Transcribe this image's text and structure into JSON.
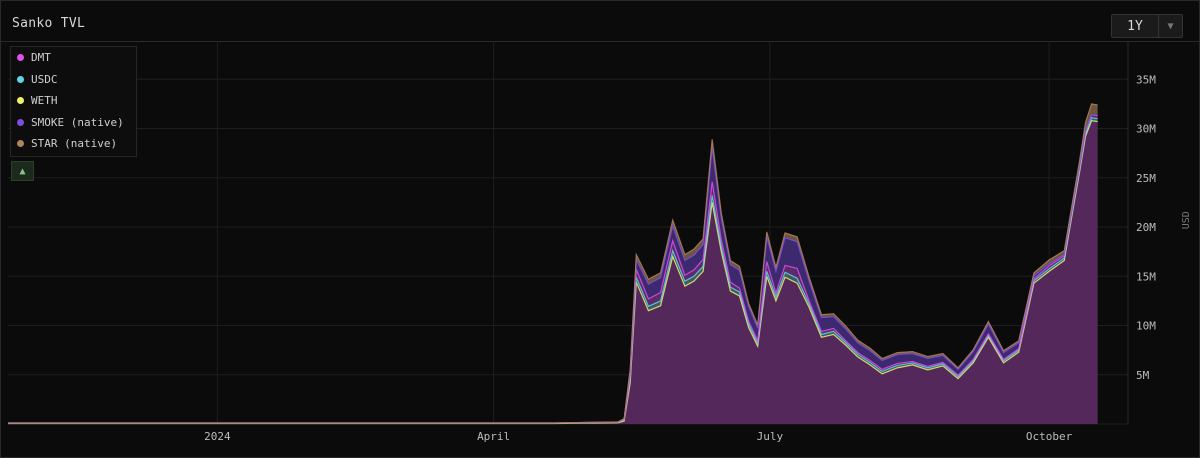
{
  "header": {
    "title": "Sanko TVL"
  },
  "range_selector": {
    "value": "1Y"
  },
  "legend_toggle": {
    "icon": "chevron-up-icon"
  },
  "chart_data": {
    "type": "area",
    "stacked": true,
    "title": "Sanko TVL",
    "ylabel": "USD",
    "ylim": [
      0,
      35000000
    ],
    "y_ticks": [
      {
        "value": 5000000,
        "label": "5M"
      },
      {
        "value": 10000000,
        "label": "10M"
      },
      {
        "value": 15000000,
        "label": "15M"
      },
      {
        "value": 20000000,
        "label": "20M"
      },
      {
        "value": 25000000,
        "label": "25M"
      },
      {
        "value": 30000000,
        "label": "30M"
      },
      {
        "value": 35000000,
        "label": "35M"
      }
    ],
    "x_ticks": [
      {
        "date": "2024-01-01",
        "label": "2024"
      },
      {
        "date": "2024-04-01",
        "label": "April"
      },
      {
        "date": "2024-07-01",
        "label": "July"
      },
      {
        "date": "2024-10-01",
        "label": "October"
      }
    ],
    "x_range": [
      "2023-10-24",
      "2024-10-27"
    ],
    "grid": true,
    "legend_position": "top-left",
    "legend": [
      {
        "name": "DMT",
        "color": "#e04ff0"
      },
      {
        "name": "USDC",
        "color": "#5fd7e8"
      },
      {
        "name": "WETH",
        "color": "#f2f06a"
      },
      {
        "name": "SMOKE (native)",
        "color": "#7d4ee0"
      },
      {
        "name": "STAR (native)",
        "color": "#b0845a"
      }
    ],
    "dates": [
      "2023-10-24",
      "2024-04-21",
      "2024-05-12",
      "2024-05-14",
      "2024-05-16",
      "2024-05-18",
      "2024-05-22",
      "2024-05-26",
      "2024-05-30",
      "2024-06-03",
      "2024-06-06",
      "2024-06-09",
      "2024-06-12",
      "2024-06-15",
      "2024-06-18",
      "2024-06-21",
      "2024-06-24",
      "2024-06-27",
      "2024-06-30",
      "2024-07-03",
      "2024-07-06",
      "2024-07-10",
      "2024-07-14",
      "2024-07-18",
      "2024-07-22",
      "2024-07-26",
      "2024-07-30",
      "2024-08-03",
      "2024-08-07",
      "2024-08-12",
      "2024-08-17",
      "2024-08-22",
      "2024-08-27",
      "2024-09-01",
      "2024-09-06",
      "2024-09-11",
      "2024-09-16",
      "2024-09-21",
      "2024-09-26",
      "2024-10-01",
      "2024-10-06",
      "2024-10-09",
      "2024-10-11",
      "2024-10-13",
      "2024-10-15",
      "2024-10-17"
    ],
    "series": [
      {
        "name": "DMT",
        "values": [
          20000,
          20000,
          20000,
          80000,
          300000,
          800000,
          750000,
          850000,
          1000000,
          600000,
          650000,
          700000,
          1400000,
          700000,
          500000,
          400000,
          300000,
          250000,
          1000000,
          400000,
          700000,
          1000000,
          300000,
          300000,
          300000,
          200000,
          200000,
          200000,
          200000,
          200000,
          150000,
          150000,
          150000,
          150000,
          150000,
          150000,
          150000,
          150000,
          200000,
          300000,
          250000,
          250000,
          250000,
          300000,
          300000,
          300000
        ]
      },
      {
        "name": "USDC",
        "values": [
          30000,
          30000,
          60000,
          100000,
          400000,
          500000,
          450000,
          500000,
          600000,
          500000,
          500000,
          500000,
          700000,
          500000,
          400000,
          400000,
          350000,
          300000,
          500000,
          400000,
          500000,
          500000,
          350000,
          300000,
          300000,
          250000,
          250000,
          250000,
          250000,
          250000,
          200000,
          200000,
          200000,
          200000,
          200000,
          200000,
          200000,
          200000,
          250000,
          250000,
          250000,
          250000,
          250000,
          300000,
          300000,
          300000
        ]
      },
      {
        "name": "WETH",
        "values": [
          50000,
          50000,
          120000,
          300000,
          4200000,
          14400000,
          11500000,
          12000000,
          17000000,
          14000000,
          14500000,
          15500000,
          22500000,
          17500000,
          13500000,
          13000000,
          9800000,
          7900000,
          15000000,
          12500000,
          14900000,
          14300000,
          11800000,
          8800000,
          9100000,
          8000000,
          6800000,
          6000000,
          5100000,
          5700000,
          6000000,
          5500000,
          5900000,
          4600000,
          6200000,
          8800000,
          6200000,
          7300000,
          14300000,
          15500000,
          16600000,
          22000000,
          25500000,
          29200000,
          30800000,
          30700000
        ]
      },
      {
        "name": "SMOKE (native)",
        "values": [
          0,
          0,
          0,
          50000,
          500000,
          1000000,
          1500000,
          1500000,
          1500000,
          1500000,
          1500000,
          1500000,
          3500000,
          2200000,
          1800000,
          1800000,
          1500000,
          1300000,
          2500000,
          2200000,
          2800000,
          2700000,
          2000000,
          1400000,
          1200000,
          1200000,
          1000000,
          1000000,
          900000,
          900000,
          800000,
          800000,
          700000,
          600000,
          800000,
          1000000,
          700000,
          600000,
          300000,
          200000,
          100000,
          50000,
          30000,
          20000,
          0,
          0
        ]
      },
      {
        "name": "STAR (native)",
        "values": [
          0,
          0,
          0,
          20000,
          200000,
          500000,
          500000,
          500000,
          600000,
          600000,
          600000,
          600000,
          800000,
          500000,
          400000,
          400000,
          300000,
          300000,
          500000,
          400000,
          500000,
          500000,
          400000,
          300000,
          300000,
          300000,
          250000,
          250000,
          200000,
          200000,
          200000,
          200000,
          200000,
          150000,
          200000,
          250000,
          200000,
          200000,
          300000,
          400000,
          400000,
          500000,
          600000,
          800000,
          1100000,
          1100000
        ]
      }
    ]
  }
}
